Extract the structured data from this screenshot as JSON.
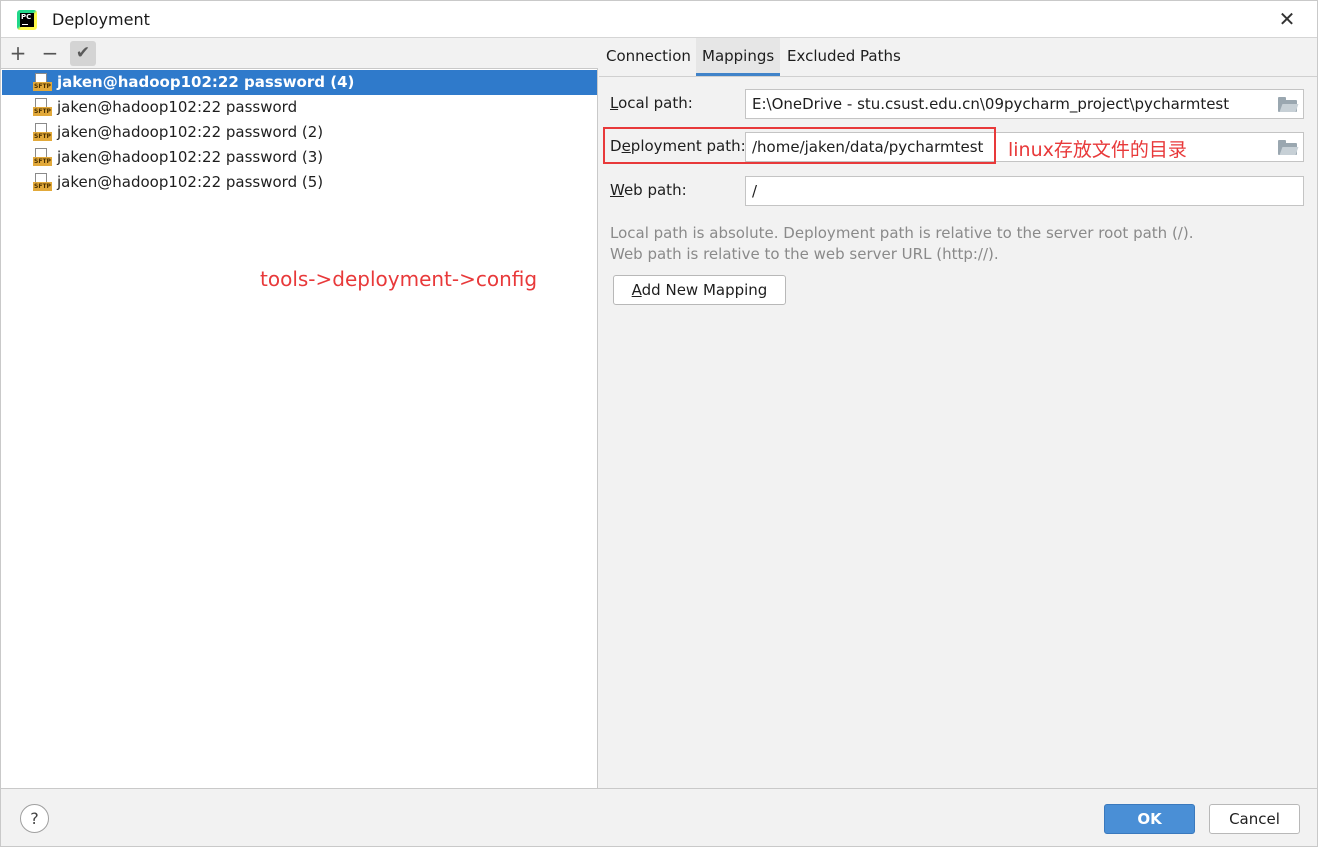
{
  "window": {
    "title": "Deployment",
    "app_icon": "pycharm-icon",
    "app_icon_text": "PC"
  },
  "left_toolbar": {
    "add_label": "+",
    "remove_label": "−",
    "check_label": "✔"
  },
  "servers": [
    {
      "name": "jaken@hadoop102:22 password (4)",
      "type_badge": "SFTP",
      "selected": true
    },
    {
      "name": "jaken@hadoop102:22 password",
      "type_badge": "SFTP",
      "selected": false
    },
    {
      "name": "jaken@hadoop102:22 password (2)",
      "type_badge": "SFTP",
      "selected": false
    },
    {
      "name": "jaken@hadoop102:22 password (3)",
      "type_badge": "SFTP",
      "selected": false
    },
    {
      "name": "jaken@hadoop102:22 password (5)",
      "type_badge": "SFTP",
      "selected": false
    }
  ],
  "annotations": {
    "left_note": "tools->deployment->config",
    "right_note": "linux存放文件的目录",
    "color": "#e8393a"
  },
  "tabs": [
    {
      "label": "Connection",
      "active": false
    },
    {
      "label": "Mappings",
      "active": true
    },
    {
      "label": "Excluded Paths",
      "active": false
    }
  ],
  "mappings": {
    "local_path_label_key": "L",
    "local_path_label_rest": "ocal path:",
    "local_path_value": "E:\\OneDrive - stu.csust.edu.cn\\09pycharm_project\\pycharmtest",
    "deployment_path_label_pre": "D",
    "deployment_path_label_key": "e",
    "deployment_path_label_rest": "ployment path:",
    "deployment_path_value": "/home/jaken/data/pycharmtest",
    "web_path_label_key": "W",
    "web_path_label_rest": "eb path:",
    "web_path_value": "/",
    "hint_line1": "Local path is absolute. Deployment path is relative to the server root path (/).",
    "hint_line2": "Web path is relative to the web server URL (http://).",
    "add_mapping_key": "A",
    "add_mapping_rest": "dd New Mapping"
  },
  "footer": {
    "help_label": "?",
    "ok_label": "OK",
    "cancel_label": "Cancel"
  },
  "colors": {
    "selection": "#2f7acb",
    "ok_button": "#4a8fd6",
    "tab_underline": "#4083c9"
  }
}
